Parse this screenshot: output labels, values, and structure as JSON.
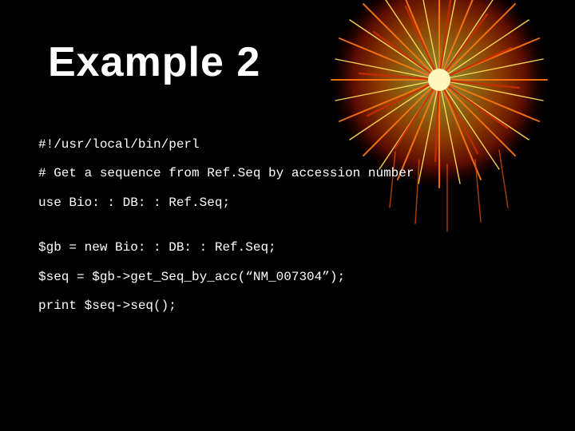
{
  "title": "Example 2",
  "code": {
    "line1": "#!/usr/local/bin/perl",
    "line2": "# Get a sequence from Ref.Seq by accession number",
    "line3": "use Bio: : DB: : Ref.Seq;",
    "line4": "$gb = new Bio: : DB: : Ref.Seq;",
    "line5": "$seq = $gb->get_Seq_by_acc(“NM_007304”);",
    "line6": "print $seq->seq();"
  }
}
